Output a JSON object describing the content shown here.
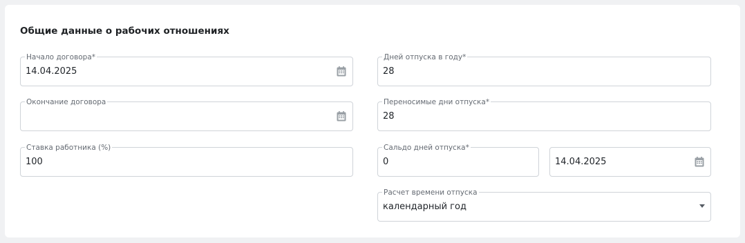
{
  "section": {
    "title": "Общие данные о рабочих отношениях"
  },
  "fields": {
    "contract_start": {
      "label": "Начало договора*",
      "value": "14.04.2025",
      "icon": "calendar-icon"
    },
    "contract_end": {
      "label": "Окончание договора",
      "value": "",
      "icon": "calendar-icon"
    },
    "employee_rate": {
      "label": "Ставка работника (%)",
      "value": "100"
    },
    "vacation_days_per_year": {
      "label": "Дней отпуска в году*",
      "value": "28"
    },
    "carryover_vacation_days": {
      "label": "Переносимые дни отпуска*",
      "value": "28"
    },
    "vacation_balance": {
      "label": "Сальдо дней отпуска*",
      "value": "0"
    },
    "vacation_balance_date": {
      "value": "14.04.2025",
      "icon": "calendar-icon"
    },
    "vacation_calc": {
      "label": "Расчет времени отпуска",
      "value": "календарный год",
      "icon": "chevron-down-icon"
    }
  },
  "colors": {
    "border": "#cfd3d8",
    "label": "#646a72",
    "icon": "#9aa0a6",
    "text": "#1f2328",
    "background": "#f0f1f3"
  }
}
